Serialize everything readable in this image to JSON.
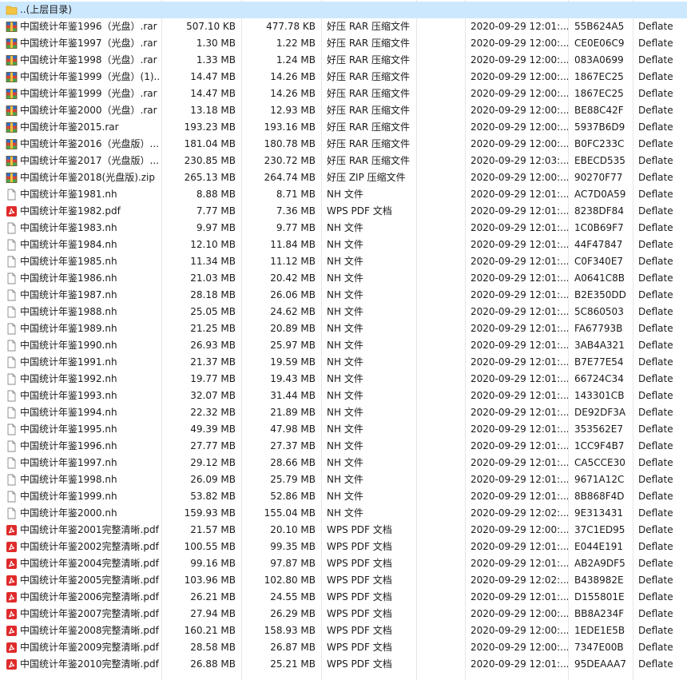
{
  "parent_row": {
    "label": "..(上层目录)",
    "icon": "folder-icon"
  },
  "rows": [
    {
      "name": "中国统计年鉴1996（光盘）.rar",
      "size": "507.10 KB",
      "packed": "477.78 KB",
      "type": "好压 RAR 压缩文件",
      "modified": "2020-09-29 12:01:...",
      "crc": "55B624A5",
      "method": "Deflate",
      "icon": "archive-icon"
    },
    {
      "name": "中国统计年鉴1997（光盘）.rar",
      "size": "1.30 MB",
      "packed": "1.22 MB",
      "type": "好压 RAR 压缩文件",
      "modified": "2020-09-29 12:00:...",
      "crc": "CE0E06C9",
      "method": "Deflate",
      "icon": "archive-icon"
    },
    {
      "name": "中国统计年鉴1998（光盘）.rar",
      "size": "1.33 MB",
      "packed": "1.24 MB",
      "type": "好压 RAR 压缩文件",
      "modified": "2020-09-29 12:00:...",
      "crc": "083A0699",
      "method": "Deflate",
      "icon": "archive-icon"
    },
    {
      "name": "中国统计年鉴1999（光盘）(1)....",
      "size": "14.47 MB",
      "packed": "14.26 MB",
      "type": "好压 RAR 压缩文件",
      "modified": "2020-09-29 12:00:...",
      "crc": "1867EC25",
      "method": "Deflate",
      "icon": "archive-icon"
    },
    {
      "name": "中国统计年鉴1999（光盘）.rar",
      "size": "14.47 MB",
      "packed": "14.26 MB",
      "type": "好压 RAR 压缩文件",
      "modified": "2020-09-29 12:00:...",
      "crc": "1867EC25",
      "method": "Deflate",
      "icon": "archive-icon"
    },
    {
      "name": "中国统计年鉴2000（光盘）.rar",
      "size": "13.18 MB",
      "packed": "12.93 MB",
      "type": "好压 RAR 压缩文件",
      "modified": "2020-09-29 12:00:...",
      "crc": "BE88C42F",
      "method": "Deflate",
      "icon": "archive-icon"
    },
    {
      "name": "中国统计年鉴2015.rar",
      "size": "193.23 MB",
      "packed": "193.16 MB",
      "type": "好压 RAR 压缩文件",
      "modified": "2020-09-29 12:00:...",
      "crc": "5937B6D9",
      "method": "Deflate",
      "icon": "archive-icon"
    },
    {
      "name": "中国统计年鉴2016（光盘版）....",
      "size": "181.04 MB",
      "packed": "180.78 MB",
      "type": "好压 RAR 压缩文件",
      "modified": "2020-09-29 12:00:...",
      "crc": "B0FC233C",
      "method": "Deflate",
      "icon": "archive-icon"
    },
    {
      "name": "中国统计年鉴2017（光盘版）....",
      "size": "230.85 MB",
      "packed": "230.72 MB",
      "type": "好压 RAR 压缩文件",
      "modified": "2020-09-29 12:03:...",
      "crc": "EBECD535",
      "method": "Deflate",
      "icon": "archive-icon"
    },
    {
      "name": "中国统计年鉴2018(光盘版).zip",
      "size": "265.13 MB",
      "packed": "264.74 MB",
      "type": "好压 ZIP 压缩文件",
      "modified": "2020-09-29 12:00:...",
      "crc": "90270F77",
      "method": "Deflate",
      "icon": "archive-icon"
    },
    {
      "name": "中国统计年鉴1981.nh",
      "size": "8.88 MB",
      "packed": "8.71 MB",
      "type": "NH 文件",
      "modified": "2020-09-29 12:01:...",
      "crc": "AC7D0A59",
      "method": "Deflate",
      "icon": "file-icon"
    },
    {
      "name": "中国统计年鉴1982.pdf",
      "size": "7.77 MB",
      "packed": "7.36 MB",
      "type": "WPS PDF 文档",
      "modified": "2020-09-29 12:01:...",
      "crc": "8238DF84",
      "method": "Deflate",
      "icon": "pdf-icon"
    },
    {
      "name": "中国统计年鉴1983.nh",
      "size": "9.97 MB",
      "packed": "9.77 MB",
      "type": "NH 文件",
      "modified": "2020-09-29 12:01:...",
      "crc": "1C0B69F7",
      "method": "Deflate",
      "icon": "file-icon"
    },
    {
      "name": "中国统计年鉴1984.nh",
      "size": "12.10 MB",
      "packed": "11.84 MB",
      "type": "NH 文件",
      "modified": "2020-09-29 12:01:...",
      "crc": "44F47847",
      "method": "Deflate",
      "icon": "file-icon"
    },
    {
      "name": "中国统计年鉴1985.nh",
      "size": "11.34 MB",
      "packed": "11.12 MB",
      "type": "NH 文件",
      "modified": "2020-09-29 12:01:...",
      "crc": "C0F340E7",
      "method": "Deflate",
      "icon": "file-icon"
    },
    {
      "name": "中国统计年鉴1986.nh",
      "size": "21.03 MB",
      "packed": "20.42 MB",
      "type": "NH 文件",
      "modified": "2020-09-29 12:01:...",
      "crc": "A0641C8B",
      "method": "Deflate",
      "icon": "file-icon"
    },
    {
      "name": "中国统计年鉴1987.nh",
      "size": "28.18 MB",
      "packed": "26.06 MB",
      "type": "NH 文件",
      "modified": "2020-09-29 12:01:...",
      "crc": "B2E350DD",
      "method": "Deflate",
      "icon": "file-icon"
    },
    {
      "name": "中国统计年鉴1988.nh",
      "size": "25.05 MB",
      "packed": "24.62 MB",
      "type": "NH 文件",
      "modified": "2020-09-29 12:01:...",
      "crc": "5C860503",
      "method": "Deflate",
      "icon": "file-icon"
    },
    {
      "name": "中国统计年鉴1989.nh",
      "size": "21.25 MB",
      "packed": "20.89 MB",
      "type": "NH 文件",
      "modified": "2020-09-29 12:01:...",
      "crc": "FA67793B",
      "method": "Deflate",
      "icon": "file-icon"
    },
    {
      "name": "中国统计年鉴1990.nh",
      "size": "26.93 MB",
      "packed": "25.97 MB",
      "type": "NH 文件",
      "modified": "2020-09-29 12:01:...",
      "crc": "3AB4A321",
      "method": "Deflate",
      "icon": "file-icon"
    },
    {
      "name": "中国统计年鉴1991.nh",
      "size": "21.37 MB",
      "packed": "19.59 MB",
      "type": "NH 文件",
      "modified": "2020-09-29 12:01:...",
      "crc": "B7E77E54",
      "method": "Deflate",
      "icon": "file-icon"
    },
    {
      "name": "中国统计年鉴1992.nh",
      "size": "19.77 MB",
      "packed": "19.43 MB",
      "type": "NH 文件",
      "modified": "2020-09-29 12:01:...",
      "crc": "66724C34",
      "method": "Deflate",
      "icon": "file-icon"
    },
    {
      "name": "中国统计年鉴1993.nh",
      "size": "32.07 MB",
      "packed": "31.44 MB",
      "type": "NH 文件",
      "modified": "2020-09-29 12:01:...",
      "crc": "143301CB",
      "method": "Deflate",
      "icon": "file-icon"
    },
    {
      "name": "中国统计年鉴1994.nh",
      "size": "22.32 MB",
      "packed": "21.89 MB",
      "type": "NH 文件",
      "modified": "2020-09-29 12:01:...",
      "crc": "DE92DF3A",
      "method": "Deflate",
      "icon": "file-icon"
    },
    {
      "name": "中国统计年鉴1995.nh",
      "size": "49.39 MB",
      "packed": "47.98 MB",
      "type": "NH 文件",
      "modified": "2020-09-29 12:01:...",
      "crc": "353562E7",
      "method": "Deflate",
      "icon": "file-icon"
    },
    {
      "name": "中国统计年鉴1996.nh",
      "size": "27.77 MB",
      "packed": "27.37 MB",
      "type": "NH 文件",
      "modified": "2020-09-29 12:01:...",
      "crc": "1CC9F4B7",
      "method": "Deflate",
      "icon": "file-icon"
    },
    {
      "name": "中国统计年鉴1997.nh",
      "size": "29.12 MB",
      "packed": "28.66 MB",
      "type": "NH 文件",
      "modified": "2020-09-29 12:01:...",
      "crc": "CA5CCE30",
      "method": "Deflate",
      "icon": "file-icon"
    },
    {
      "name": "中国统计年鉴1998.nh",
      "size": "26.09 MB",
      "packed": "25.79 MB",
      "type": "NH 文件",
      "modified": "2020-09-29 12:01:...",
      "crc": "9671A12C",
      "method": "Deflate",
      "icon": "file-icon"
    },
    {
      "name": "中国统计年鉴1999.nh",
      "size": "53.82 MB",
      "packed": "52.86 MB",
      "type": "NH 文件",
      "modified": "2020-09-29 12:01:...",
      "crc": "8B868F4D",
      "method": "Deflate",
      "icon": "file-icon"
    },
    {
      "name": "中国统计年鉴2000.nh",
      "size": "159.93 MB",
      "packed": "155.04 MB",
      "type": "NH 文件",
      "modified": "2020-09-29 12:02:...",
      "crc": "9E313431",
      "method": "Deflate",
      "icon": "file-icon"
    },
    {
      "name": "中国统计年鉴2001完整清晰.pdf",
      "size": "21.57 MB",
      "packed": "20.10 MB",
      "type": "WPS PDF 文档",
      "modified": "2020-09-29 12:00:...",
      "crc": "37C1ED95",
      "method": "Deflate",
      "icon": "pdf-icon"
    },
    {
      "name": "中国统计年鉴2002完整清晰.pdf",
      "size": "100.55 MB",
      "packed": "99.35 MB",
      "type": "WPS PDF 文档",
      "modified": "2020-09-29 12:01:...",
      "crc": "E044E191",
      "method": "Deflate",
      "icon": "pdf-icon"
    },
    {
      "name": "中国统计年鉴2004完整清晰.pdf",
      "size": "99.16 MB",
      "packed": "97.87 MB",
      "type": "WPS PDF 文档",
      "modified": "2020-09-29 12:01:...",
      "crc": "AB2A9DF5",
      "method": "Deflate",
      "icon": "pdf-icon"
    },
    {
      "name": "中国统计年鉴2005完整清晰.pdf",
      "size": "103.96 MB",
      "packed": "102.80 MB",
      "type": "WPS PDF 文档",
      "modified": "2020-09-29 12:02:...",
      "crc": "B438982E",
      "method": "Deflate",
      "icon": "pdf-icon"
    },
    {
      "name": "中国统计年鉴2006完整清晰.pdf",
      "size": "26.21 MB",
      "packed": "24.55 MB",
      "type": "WPS PDF 文档",
      "modified": "2020-09-29 12:01:...",
      "crc": "D155801E",
      "method": "Deflate",
      "icon": "pdf-icon"
    },
    {
      "name": "中国统计年鉴2007完整清晰.pdf",
      "size": "27.94 MB",
      "packed": "26.29 MB",
      "type": "WPS PDF 文档",
      "modified": "2020-09-29 12:00:...",
      "crc": "BB8A234F",
      "method": "Deflate",
      "icon": "pdf-icon"
    },
    {
      "name": "中国统计年鉴2008完整清晰.pdf",
      "size": "160.21 MB",
      "packed": "158.93 MB",
      "type": "WPS PDF 文档",
      "modified": "2020-09-29 12:00:...",
      "crc": "1EDE1E5B",
      "method": "Deflate",
      "icon": "pdf-icon"
    },
    {
      "name": "中国统计年鉴2009完整清晰.pdf",
      "size": "28.58 MB",
      "packed": "26.87 MB",
      "type": "WPS PDF 文档",
      "modified": "2020-09-29 12:00:...",
      "crc": "7347E00B",
      "method": "Deflate",
      "icon": "pdf-icon"
    },
    {
      "name": "中国统计年鉴2010完整清晰.pdf",
      "size": "26.88 MB",
      "packed": "25.21 MB",
      "type": "WPS PDF 文档",
      "modified": "2020-09-29 12:01:...",
      "crc": "95DEAAA7",
      "method": "Deflate",
      "icon": "pdf-icon"
    }
  ],
  "colors": {
    "selection": "#cce8ff",
    "folder": "#f4c542",
    "pdf": "#e02b2b",
    "archive_blue": "#2a6fc9",
    "archive_red": "#d64535",
    "archive_green": "#4aa84a"
  }
}
